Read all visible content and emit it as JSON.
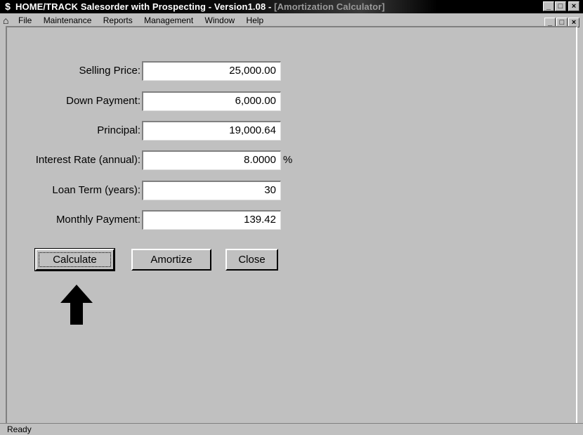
{
  "window": {
    "title_app": "HOME/TRACK Salesorder with Prospecting - Version1.08 - ",
    "title_doc": "[Amortization Calculator]",
    "min_glyph": "_",
    "max_glyph": "□",
    "close_glyph": "×"
  },
  "menu": {
    "items": [
      {
        "label": "File"
      },
      {
        "label": "Maintenance"
      },
      {
        "label": "Reports"
      },
      {
        "label": "Management"
      },
      {
        "label": "Window"
      },
      {
        "label": "Help"
      }
    ]
  },
  "form": {
    "selling_price_label": "Selling Price:",
    "selling_price_value": "25,000.00",
    "down_payment_label": "Down Payment:",
    "down_payment_value": "6,000.00",
    "principal_label": "Principal:",
    "principal_value": "19,000.64",
    "interest_rate_label": "Interest Rate (annual):",
    "interest_rate_value": "8.0000",
    "interest_rate_unit": "%",
    "loan_term_label": "Loan Term (years):",
    "loan_term_value": "30",
    "monthly_payment_label": "Monthly Payment:",
    "monthly_payment_value": "139.42"
  },
  "buttons": {
    "calculate": "Calculate",
    "amortize": "Amortize",
    "close": "Close"
  },
  "status": {
    "text": "Ready"
  },
  "icons": {
    "app_icon": "dollar-icon",
    "doc_icon": "home-icon",
    "annotation": "up-arrow-icon"
  }
}
